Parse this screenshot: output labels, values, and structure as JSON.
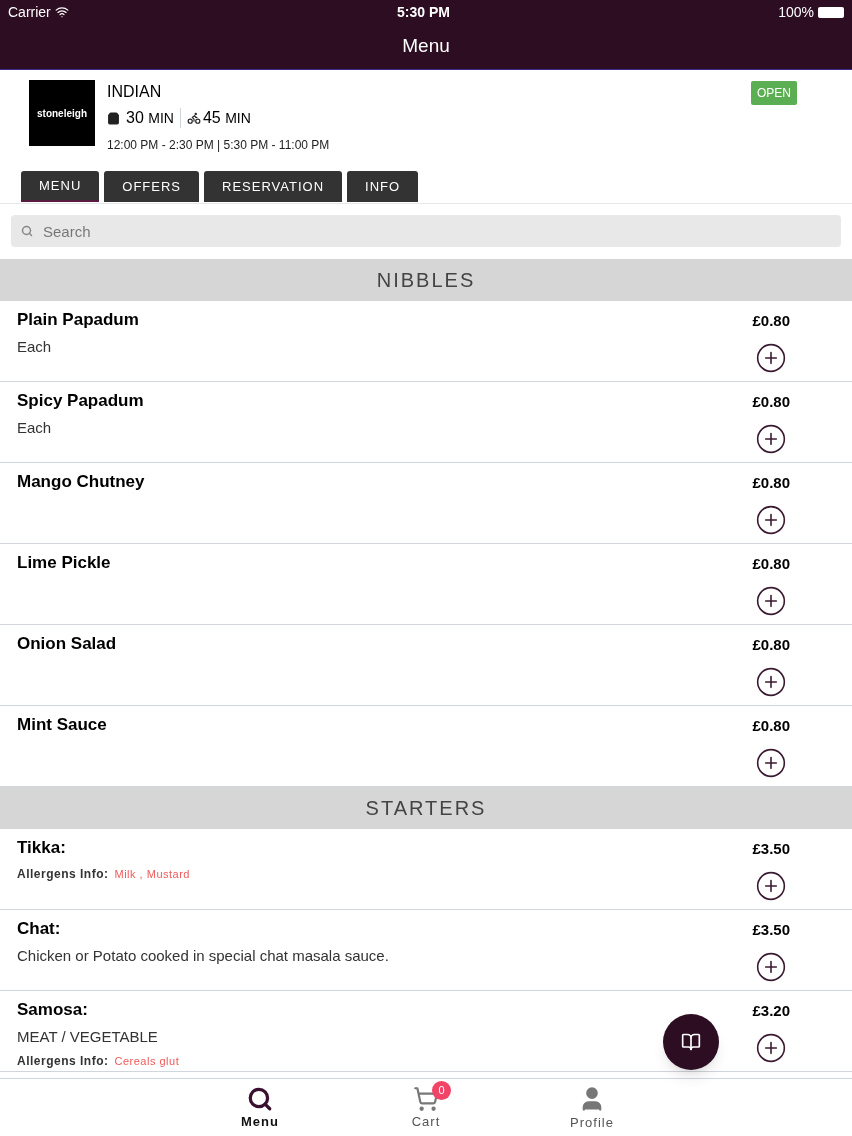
{
  "status_bar": {
    "carrier": "Carrier",
    "time": "5:30 PM",
    "battery": "100%"
  },
  "nav": {
    "title": "Menu"
  },
  "restaurant": {
    "logo": "stoneleigh",
    "cuisine": "INDIAN",
    "collection_time": "30",
    "collection_unit": "MIN",
    "delivery_time": "45",
    "delivery_unit": "MIN",
    "hours": "12:00 PM - 2:30 PM | 5:30 PM - 11:00 PM",
    "status": "OPEN"
  },
  "tabs": [
    {
      "label": "MENU",
      "selected": true
    },
    {
      "label": "OFFERS",
      "selected": false
    },
    {
      "label": "RESERVATION",
      "selected": false
    },
    {
      "label": "INFO",
      "selected": false
    }
  ],
  "search": {
    "placeholder": "Search"
  },
  "sections": [
    {
      "title": "NIBBLES",
      "items": [
        {
          "name": "Plain Papadum",
          "description": "Each",
          "price": "£0.80"
        },
        {
          "name": "Spicy Papadum",
          "description": "Each",
          "price": "£0.80"
        },
        {
          "name": "Mango Chutney",
          "price": "£0.80"
        },
        {
          "name": "Lime Pickle",
          "price": "£0.80"
        },
        {
          "name": "Onion Salad",
          "price": "£0.80"
        },
        {
          "name": "Mint Sauce",
          "price": "£0.80"
        }
      ]
    },
    {
      "title": "STARTERS",
      "items": [
        {
          "name": "Tikka:",
          "allergens_label": "Allergens Info:",
          "allergens": "Milk , Mustard",
          "price": "£3.50"
        },
        {
          "name": "Chat:",
          "description": "Chicken or Potato cooked in special chat masala sauce.",
          "price": "£3.50"
        },
        {
          "name": "Samosa:",
          "description": "MEAT / VEGETABLE",
          "allergens_label": "Allergens Info:",
          "allergens": "Cereals glut",
          "price": "£3.20"
        }
      ]
    }
  ],
  "bottom_tabs": [
    {
      "label": "Menu",
      "kind": "search",
      "selected": true
    },
    {
      "label": "Cart",
      "kind": "cart",
      "selected": false,
      "badge": "0"
    },
    {
      "label": "Profile",
      "kind": "person",
      "selected": false
    }
  ]
}
